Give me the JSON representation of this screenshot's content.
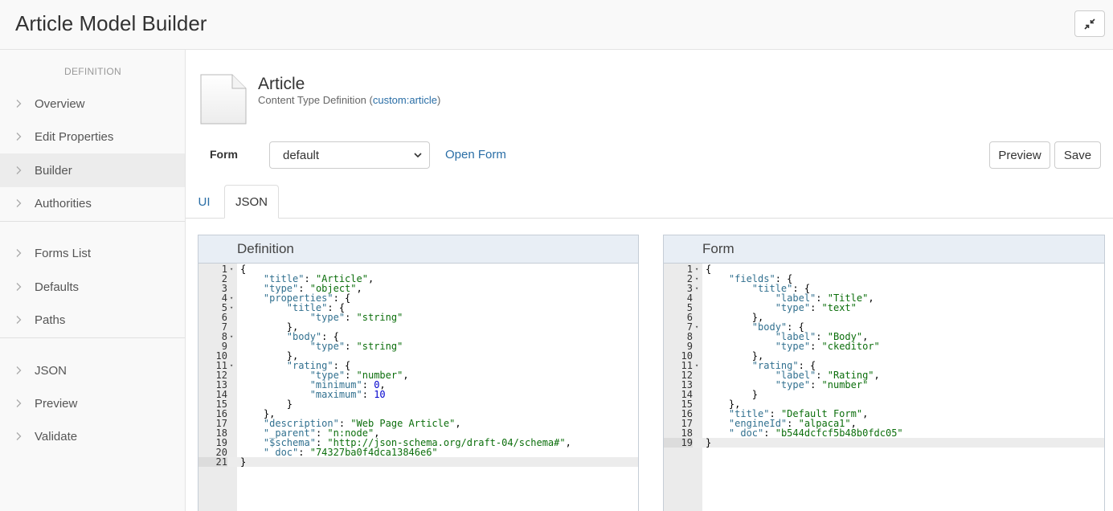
{
  "app": {
    "title": "Article Model Builder"
  },
  "sidebar": {
    "heading": "DEFINITION",
    "items": [
      {
        "label": "Overview"
      },
      {
        "label": "Edit Properties"
      },
      {
        "label": "Builder"
      },
      {
        "label": "Authorities"
      },
      {
        "label": "Forms List"
      },
      {
        "label": "Defaults"
      },
      {
        "label": "Paths"
      },
      {
        "label": "JSON"
      },
      {
        "label": "Preview"
      },
      {
        "label": "Validate"
      }
    ],
    "active": "Builder"
  },
  "content_type": {
    "title": "Article",
    "subtitle_prefix": "Content Type Definition (",
    "qname": "custom:article",
    "subtitle_suffix": ")"
  },
  "form_bar": {
    "label": "Form",
    "selected": "default",
    "open_form": "Open Form",
    "preview": "Preview",
    "save": "Save"
  },
  "tabs": [
    {
      "label": "UI"
    },
    {
      "label": "JSON"
    }
  ],
  "active_tab": "JSON",
  "definition_panel": {
    "title": "Definition",
    "lines": [
      "{",
      "    \"title\": \"Article\",",
      "    \"type\": \"object\",",
      "    \"properties\": {",
      "        \"title\": {",
      "            \"type\": \"string\"",
      "        },",
      "        \"body\": {",
      "            \"type\": \"string\"",
      "        },",
      "        \"rating\": {",
      "            \"type\": \"number\",",
      "            \"minimum\": 0,",
      "            \"maximum\": 10",
      "        }",
      "    },",
      "    \"description\": \"Web Page Article\",",
      "    \"_parent\": \"n:node\",",
      "    \"$schema\": \"http://json-schema.org/draft-04/schema#\",",
      "    \"_doc\": \"74327ba0f4dca13846e6\"",
      "}"
    ],
    "fold_lines": [
      1,
      4,
      5,
      8,
      11
    ],
    "active_line": 21
  },
  "form_panel": {
    "title": "Form",
    "lines": [
      "{",
      "    \"fields\": {",
      "        \"title\": {",
      "            \"label\": \"Title\",",
      "            \"type\": \"text\"",
      "        },",
      "        \"body\": {",
      "            \"label\": \"Body\",",
      "            \"type\": \"ckeditor\"",
      "        },",
      "        \"rating\": {",
      "            \"label\": \"Rating\",",
      "            \"type\": \"number\"",
      "        }",
      "    },",
      "    \"title\": \"Default Form\",",
      "    \"engineId\": \"alpaca1\",",
      "    \"_doc\": \"b544dcfcf5b48b0fdc05\"",
      "}"
    ],
    "fold_lines": [
      1,
      2,
      3,
      7,
      11
    ],
    "active_line": 19
  },
  "icons": {
    "collapse": "compress-arrows-icon",
    "chevron": "chevron-right-icon",
    "document": "document-icon"
  }
}
